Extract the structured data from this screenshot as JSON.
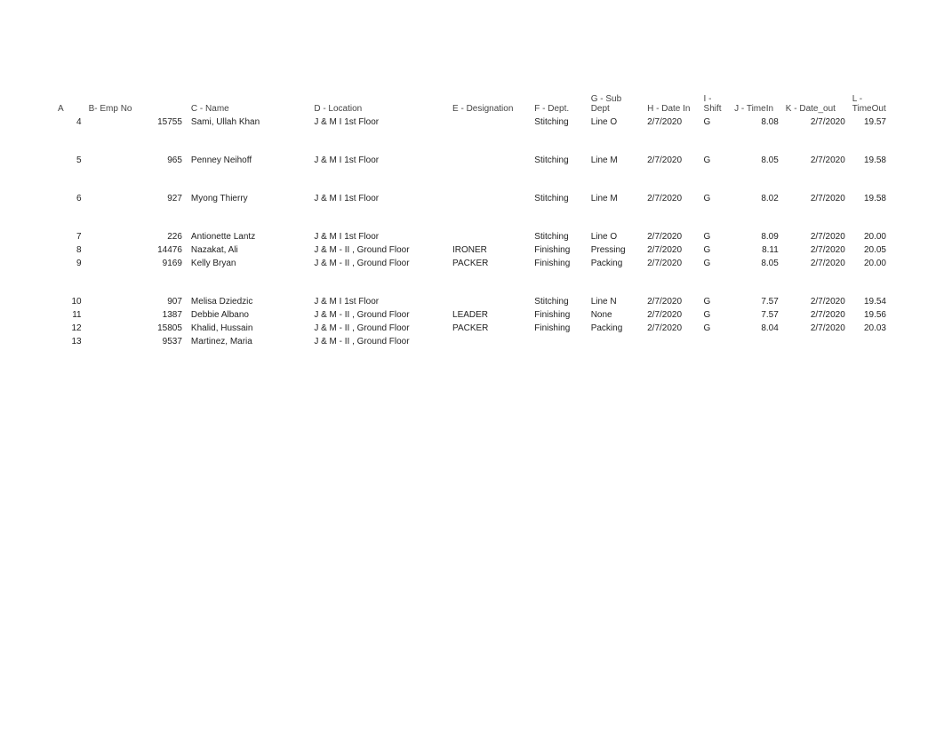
{
  "headers": {
    "a": "A",
    "empno": "B- Emp No",
    "name": "C - Name",
    "location": "D - Location",
    "designation": "E - Designation",
    "dept": "F - Dept.",
    "subdept": "G - Sub Dept",
    "datein": "H - Date In",
    "shift": "I - Shift",
    "timein": "J - TimeIn",
    "dateout": "K - Date_out",
    "timeout": "L - TimeOut"
  },
  "rows": [
    {
      "a": "4",
      "empno": "15755",
      "name": "Sami, Ullah Khan",
      "location": "J & M I 1st Floor",
      "designation": "",
      "dept": "Stitching",
      "subdept": "Line O",
      "datein": "2/7/2020",
      "shift": "G",
      "timein": "8.08",
      "dateout": "2/7/2020",
      "timeout": "19.57",
      "blurred": false,
      "spacer": false
    },
    {
      "a": "5",
      "empno": "965",
      "name": "Penney Neihoff",
      "location": "J & M I 1st Floor",
      "designation": "",
      "dept": "Stitching",
      "subdept": "Line M",
      "datein": "2/7/2020",
      "shift": "G",
      "timein": "8.05",
      "dateout": "2/7/2020",
      "timeout": "19.58",
      "blurred": false,
      "spacer": true
    },
    {
      "a": "6",
      "empno": "927",
      "name": "Myong Thierry",
      "location": "J & M I 1st Floor",
      "designation": "",
      "dept": "Stitching",
      "subdept": "Line M",
      "datein": "2/7/2020",
      "shift": "G",
      "timein": "8.02",
      "dateout": "2/7/2020",
      "timeout": "19.58",
      "blurred": false,
      "spacer": true
    },
    {
      "a": "7",
      "empno": "226",
      "name": "Antionette Lantz",
      "location": "J & M I 1st Floor",
      "designation": "",
      "dept": "Stitching",
      "subdept": "Line O",
      "datein": "2/7/2020",
      "shift": "G",
      "timein": "8.09",
      "dateout": "2/7/2020",
      "timeout": "20.00",
      "blurred": false,
      "spacer": true
    },
    {
      "a": "8",
      "empno": "14476",
      "name": "Nazakat, Ali",
      "location": "J & M - II , Ground Floor",
      "designation": "IRONER",
      "dept": "Finishing",
      "subdept": "Pressing",
      "datein": "2/7/2020",
      "shift": "G",
      "timein": "8.11",
      "dateout": "2/7/2020",
      "timeout": "20.05",
      "blurred": false,
      "spacer": false
    },
    {
      "a": "9",
      "empno": "9169",
      "name": "Kelly Bryan",
      "location": "J & M - II , Ground Floor",
      "designation": "PACKER",
      "dept": "Finishing",
      "subdept": "Packing",
      "datein": "2/7/2020",
      "shift": "G",
      "timein": "8.05",
      "dateout": "2/7/2020",
      "timeout": "20.00",
      "blurred": false,
      "spacer": false
    },
    {
      "a": "10",
      "empno": "907",
      "name": "Melisa Dziedzic",
      "location": "J & M I 1st Floor",
      "designation": "",
      "dept": "Stitching",
      "subdept": "Line N",
      "datein": "2/7/2020",
      "shift": "G",
      "timein": "7.57",
      "dateout": "2/7/2020",
      "timeout": "19.54",
      "blurred": false,
      "spacer": true
    },
    {
      "a": "11",
      "empno": "1387",
      "name": "Debbie Albano",
      "location": "J & M - II , Ground Floor",
      "designation": "LEADER",
      "dept": "Finishing",
      "subdept": "None",
      "datein": "2/7/2020",
      "shift": "G",
      "timein": "7.57",
      "dateout": "2/7/2020",
      "timeout": "19.56",
      "blurred": false,
      "spacer": false
    },
    {
      "a": "12",
      "empno": "15805",
      "name": "Khalid, Hussain",
      "location": "J & M - II , Ground Floor",
      "designation": "PACKER",
      "dept": "Finishing",
      "subdept": "Packing",
      "datein": "2/7/2020",
      "shift": "G",
      "timein": "8.04",
      "dateout": "2/7/2020",
      "timeout": "20.03",
      "blurred": false,
      "spacer": false
    },
    {
      "a": "13",
      "empno": "9537",
      "name": "Martinez, Maria",
      "location": "J & M - II , Ground Floor",
      "designation": "",
      "dept": "",
      "subdept": "",
      "datein": "",
      "shift": "",
      "timein": "",
      "dateout": "",
      "timeout": "",
      "blurred": false,
      "spacer": false
    }
  ]
}
